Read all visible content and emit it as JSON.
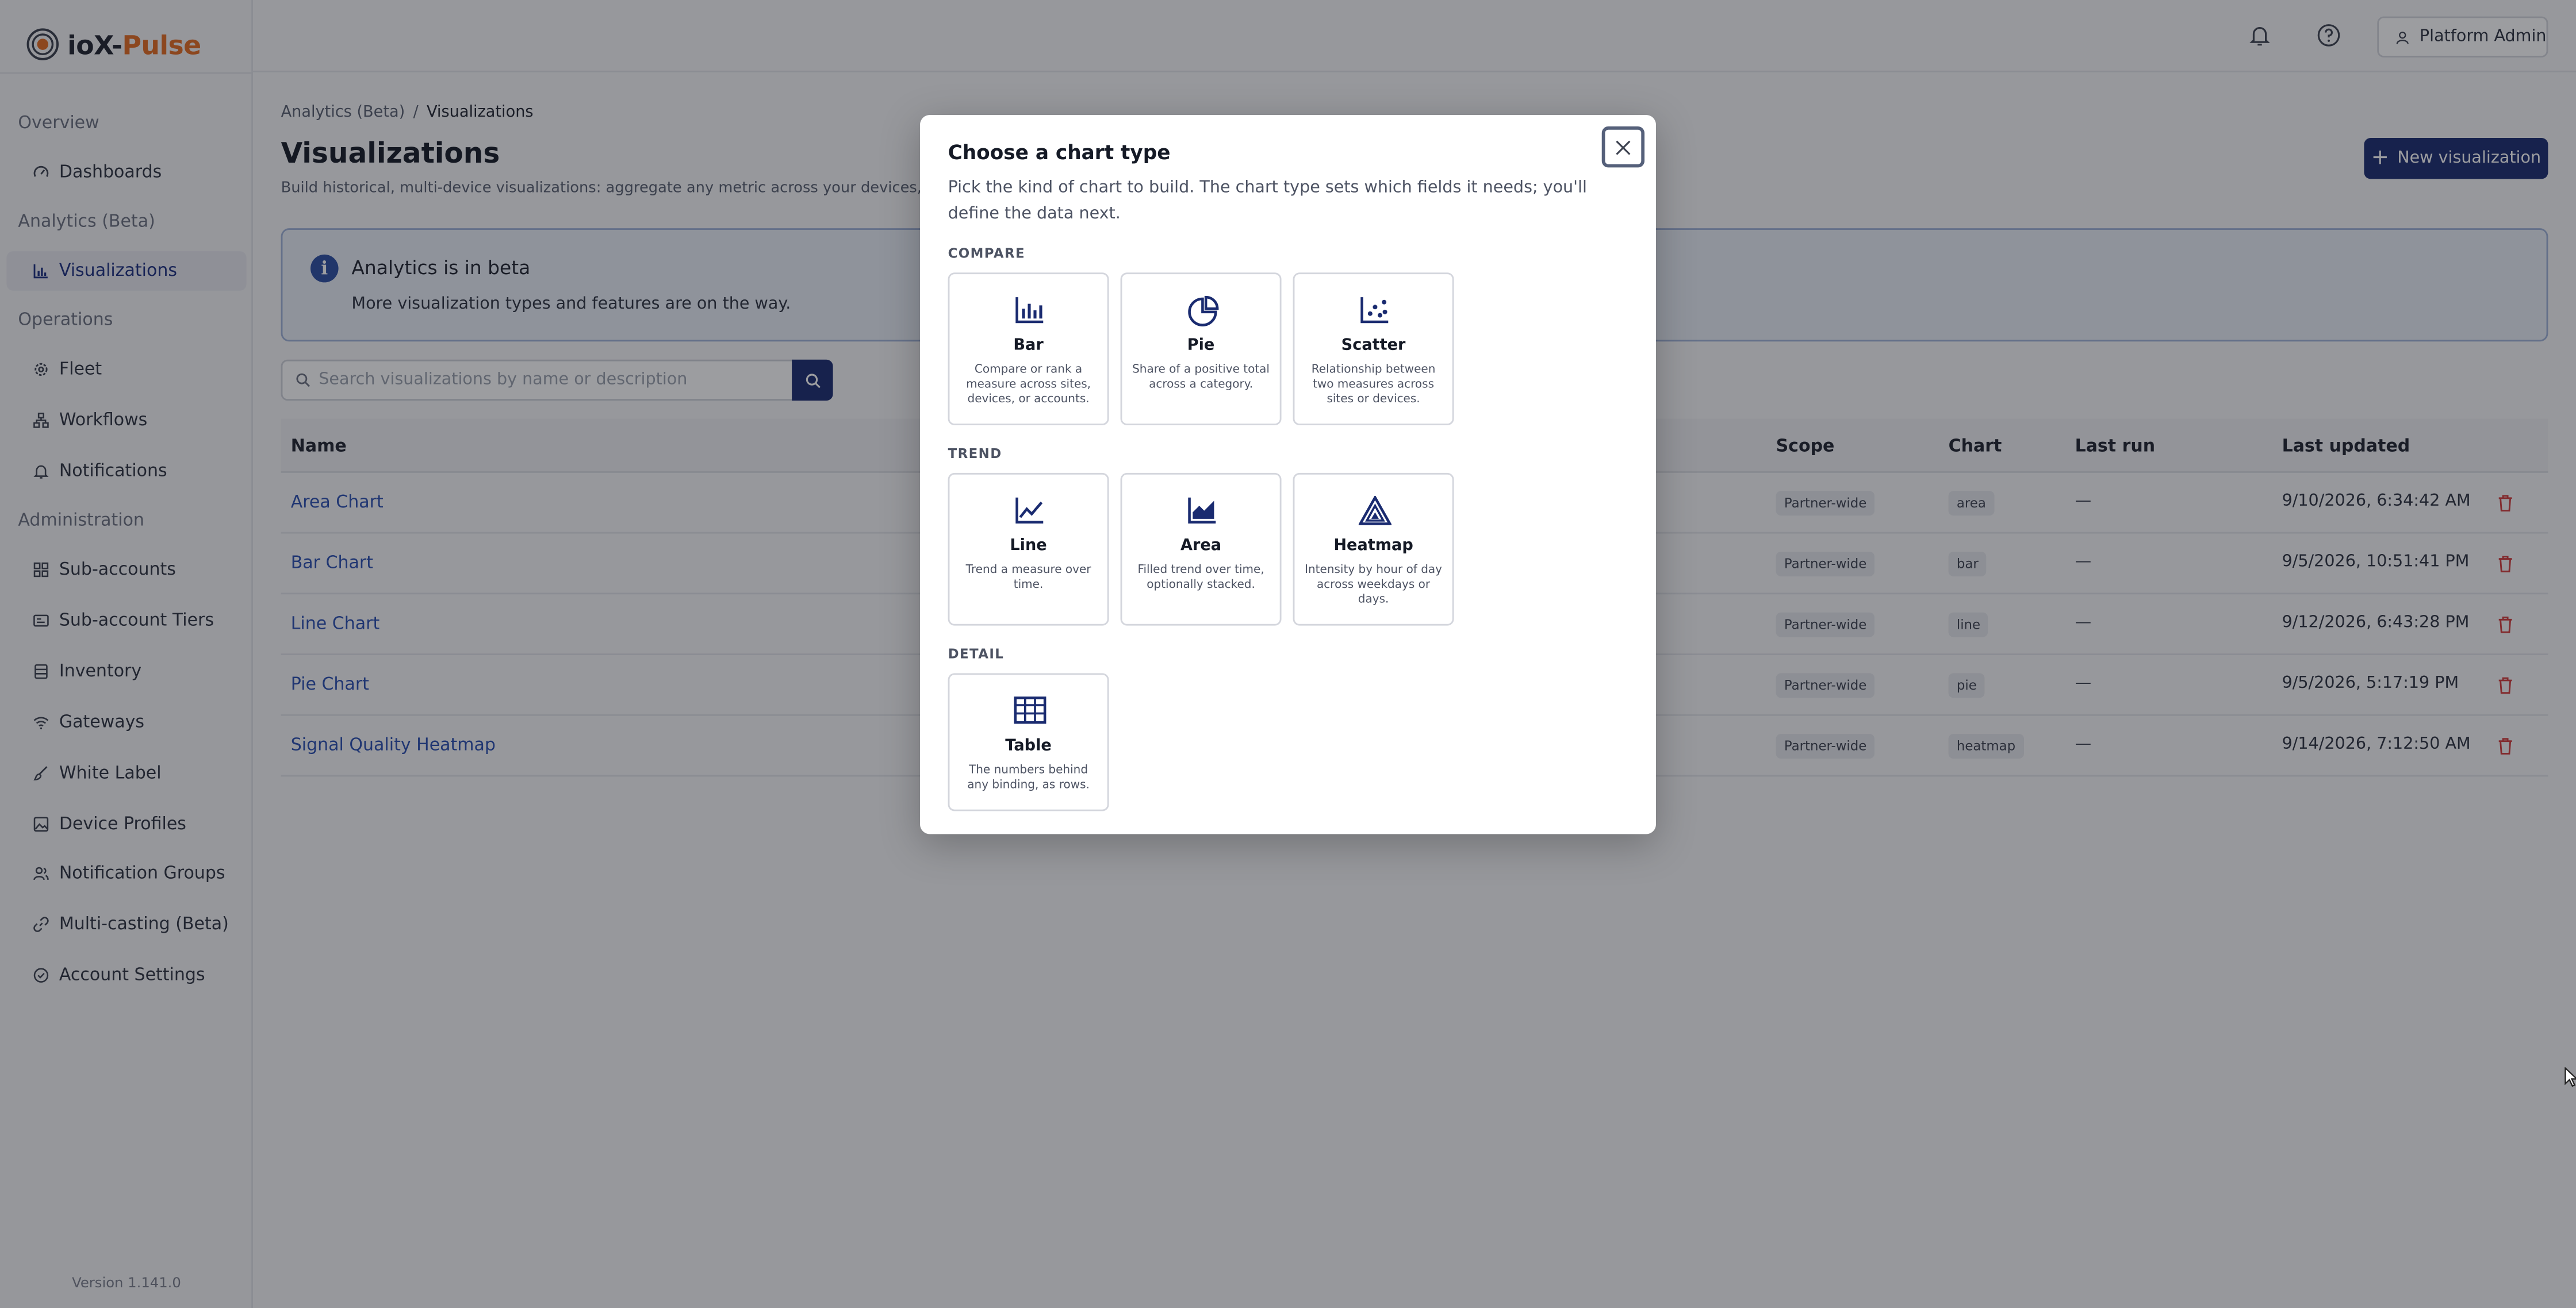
{
  "app": {
    "logo_text": "ioX-",
    "logo_accent": "Pulse",
    "version": "Version 1.141.0"
  },
  "sidebar": {
    "sections": [
      {
        "label": "Overview",
        "items": [
          {
            "label": "Dashboards",
            "icon": "gauge-icon"
          }
        ]
      },
      {
        "label": "Analytics (Beta)",
        "items": [
          {
            "label": "Visualizations",
            "icon": "bar-chart-icon",
            "active": true
          }
        ]
      },
      {
        "label": "Operations",
        "items": [
          {
            "label": "Fleet",
            "icon": "gear-icon"
          },
          {
            "label": "Workflows",
            "icon": "workflow-icon"
          },
          {
            "label": "Notifications",
            "icon": "bell-icon"
          }
        ]
      },
      {
        "label": "Administration",
        "items": [
          {
            "label": "Sub-accounts",
            "icon": "grid-icon"
          },
          {
            "label": "Sub-account Tiers",
            "icon": "id-card-icon"
          },
          {
            "label": "Inventory",
            "icon": "database-icon"
          },
          {
            "label": "Gateways",
            "icon": "wifi-icon"
          },
          {
            "label": "White Label",
            "icon": "brush-icon"
          },
          {
            "label": "Device Profiles",
            "icon": "image-icon"
          },
          {
            "label": "Notification Groups",
            "icon": "users-icon"
          },
          {
            "label": "Multi-casting (Beta)",
            "icon": "link-icon"
          },
          {
            "label": "Account Settings",
            "icon": "shield-check-icon"
          }
        ]
      }
    ]
  },
  "header": {
    "user_label": "Platform Admin",
    "icons": [
      "bell-icon",
      "help-icon",
      "user-icon"
    ]
  },
  "breadcrumb": {
    "parent": "Analytics (Beta)",
    "separator": "/",
    "current": "Visualizations"
  },
  "page": {
    "title": "Visualizations",
    "subtitle": "Build historical, multi-device visualizations: aggregate any metric across your devices, group by s",
    "new_button": "New visualization"
  },
  "banner": {
    "title": "Analytics is in beta",
    "text": "More visualization types and features are on the way."
  },
  "search": {
    "placeholder": "Search visualizations by name or description",
    "value": ""
  },
  "table": {
    "columns": {
      "name": "Name",
      "scope": "Scope",
      "chart": "Chart",
      "last_run": "Last run",
      "last_updated": "Last updated"
    },
    "rows": [
      {
        "name": "Area Chart",
        "scope": "Partner-wide",
        "chart": "area",
        "last_run": "—",
        "last_updated": "9/10/2026, 6:34:42 AM"
      },
      {
        "name": "Bar Chart",
        "scope": "Partner-wide",
        "chart": "bar",
        "last_run": "—",
        "last_updated": "9/5/2026, 10:51:41 PM"
      },
      {
        "name": "Line Chart",
        "scope": "Partner-wide",
        "chart": "line",
        "last_run": "—",
        "last_updated": "9/12/2026, 6:43:28 PM"
      },
      {
        "name": "Pie Chart",
        "scope": "Partner-wide",
        "chart": "pie",
        "last_run": "—",
        "last_updated": "9/5/2026, 5:17:19 PM"
      },
      {
        "name": "Signal Quality Heatmap",
        "scope": "Partner-wide",
        "chart": "heatmap",
        "last_run": "—",
        "last_updated": "9/14/2026, 7:12:50 AM"
      }
    ]
  },
  "modal": {
    "title": "Choose a chart type",
    "description": "Pick the kind of chart to build. The chart type sets which fields it needs; you'll define the data next.",
    "groups": [
      {
        "label": "COMPARE",
        "options": [
          {
            "name": "Bar",
            "desc": "Compare or rank a measure across sites, devices, or accounts.",
            "icon": "bar-chart-icon"
          },
          {
            "name": "Pie",
            "desc": "Share of a positive total across a category.",
            "icon": "pie-chart-icon"
          },
          {
            "name": "Scatter",
            "desc": "Relationship between two measures across sites or devices.",
            "icon": "scatter-chart-icon"
          }
        ]
      },
      {
        "label": "TREND",
        "options": [
          {
            "name": "Line",
            "desc": "Trend a measure over time.",
            "icon": "line-chart-icon"
          },
          {
            "name": "Area",
            "desc": "Filled trend over time, optionally stacked.",
            "icon": "area-chart-icon"
          },
          {
            "name": "Heatmap",
            "desc": "Intensity by hour of day across weekdays or days.",
            "icon": "heatmap-icon"
          }
        ]
      },
      {
        "label": "DETAIL",
        "options": [
          {
            "name": "Table",
            "desc": "The numbers behind any binding, as rows.",
            "icon": "table-icon"
          }
        ]
      }
    ]
  },
  "colors": {
    "primary": "#1a2b70",
    "link": "#2a4fb0",
    "brand_accent": "#e46b22",
    "danger": "#d23b3b",
    "banner_bg": "#e9eef7"
  }
}
